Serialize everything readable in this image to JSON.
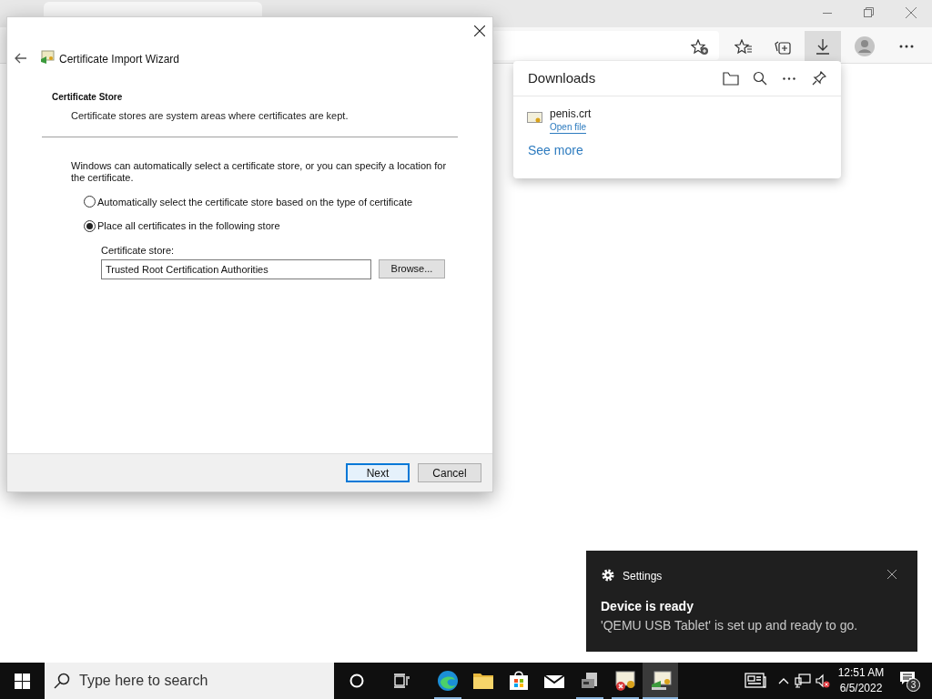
{
  "dialog": {
    "title": "Certificate Import Wizard",
    "section_title": "Certificate Store",
    "section_desc": "Certificate stores are system areas where certificates are kept.",
    "intro": "Windows can automatically select a certificate store, or you can specify a location for the certificate.",
    "options": [
      {
        "label": "Automatically select the certificate store based on the type of certificate",
        "selected": false
      },
      {
        "label": "Place all certificates in the following store",
        "selected": true
      }
    ],
    "store_label": "Certificate store:",
    "store_value": "Trusted Root Certification Authorities",
    "browse": "Browse...",
    "buttons": [
      {
        "label": "Next",
        "default": true
      },
      {
        "label": "Cancel",
        "default": false
      }
    ]
  },
  "downloads": {
    "title": "Downloads",
    "items": [
      {
        "name": "penis.crt",
        "action": "Open file"
      }
    ],
    "see_more": "See more"
  },
  "toast": {
    "app": "Settings",
    "title": "Device is ready",
    "body": "'QEMU USB Tablet' is set up and ready to go."
  },
  "taskbar": {
    "search_placeholder": "Type here to search",
    "apps": [
      {
        "kind": "edge",
        "running": true,
        "active": false
      },
      {
        "kind": "explorer",
        "running": false,
        "active": false
      },
      {
        "kind": "store",
        "running": false,
        "active": false
      },
      {
        "kind": "mail",
        "running": false,
        "active": false
      },
      {
        "kind": "drive",
        "running": true,
        "active": false
      },
      {
        "kind": "cert-error",
        "running": true,
        "active": false
      },
      {
        "kind": "cert-import",
        "running": true,
        "active": true
      }
    ],
    "time": "12:51 AM",
    "date": "6/5/2022",
    "notification_count": "3"
  }
}
